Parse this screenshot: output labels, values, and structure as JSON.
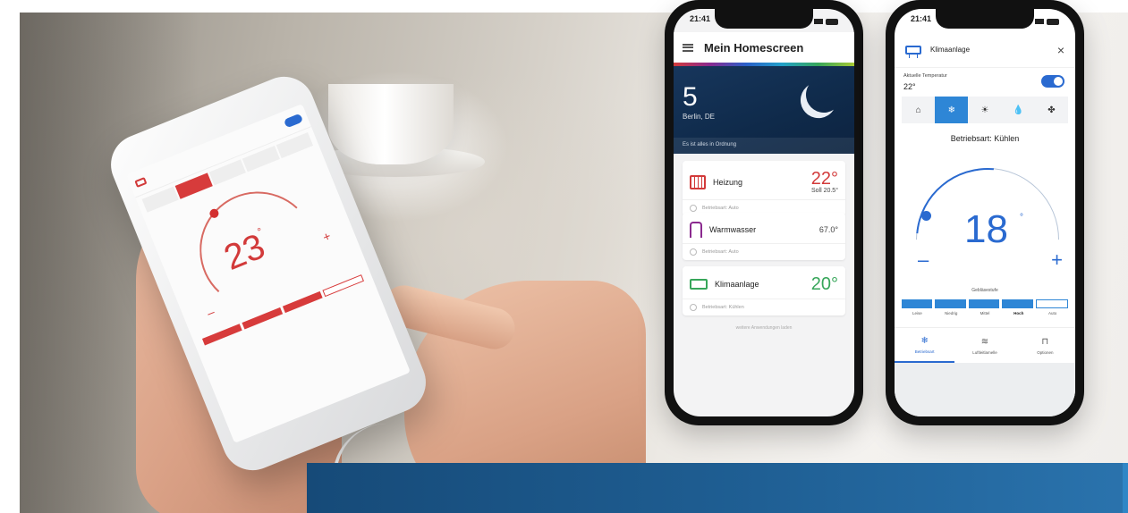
{
  "held_phone": {
    "temperature": "23",
    "temp_unit": "°",
    "plus": "+",
    "minus": "–"
  },
  "phone1": {
    "status_time": "21:41",
    "app_title": "Mein Homescreen",
    "weather": {
      "temperature": "5",
      "city": "Berlin, DE",
      "note": "Es ist alles in Ordnung"
    },
    "cards": [
      {
        "name": "Heizung",
        "value": "22°",
        "sub": "Soll 20.5°",
        "status": "Betriebsart: Auto",
        "color": "#d23a3a"
      },
      {
        "name": "Warmwasser",
        "value": "67.0°",
        "sub": "",
        "status": "Betriebsart: Auto",
        "color": "#222222"
      },
      {
        "name": "Klimaanlage",
        "value": "20°",
        "sub": "",
        "status": "Betriebsart: Kühlen",
        "color": "#37a65a"
      }
    ],
    "footnote": "weitere Anwendungen laden"
  },
  "phone2": {
    "status_time": "21:41",
    "title": "Klimaanlage",
    "close": "×",
    "current_label": "Aktuelle Temperatur",
    "current_value": "22°",
    "modes": [
      "⌂",
      "❄",
      "☀",
      "💧",
      "✤"
    ],
    "active_mode_index": 1,
    "operating_mode": "Betriebsart: Kühlen",
    "setpoint": "18",
    "setpoint_unit": "°",
    "minus": "–",
    "plus": "+",
    "fan_label": "Gebläsestufe",
    "fan_levels": [
      "Leise",
      "Niedrig",
      "Mittel",
      "Hoch",
      "Auto"
    ],
    "fan_selected_index": 3,
    "tabs": [
      "Betriebsart",
      "Luftleitlamelle",
      "Optionen"
    ],
    "tab_icons": [
      "❄",
      "≋",
      "⊓"
    ],
    "active_tab_index": 0
  },
  "colors": {
    "brand_red": "#d23a3a",
    "accent_blue": "#2a6ad0",
    "banner_blue": "#164a78"
  }
}
